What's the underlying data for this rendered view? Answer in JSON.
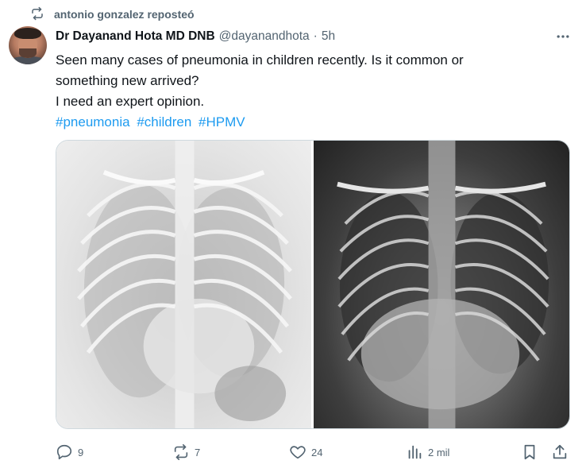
{
  "repost": {
    "text": "antonio gonzalez reposteó",
    "icon": "repost-icon"
  },
  "author": {
    "name": "Dr Dayanand Hota MD DNB",
    "handle": "@dayanandhota",
    "separator": "·",
    "time": "5h"
  },
  "body": {
    "lines": [
      "Seen many cases of pneumonia in children recently. Is it common or",
      "something new arrived?",
      "I need an expert opinion."
    ],
    "hashtags": [
      "#pneumonia",
      "#children",
      "#HPMV"
    ]
  },
  "media": {
    "images": [
      "chest-xray-left",
      "chest-xray-right"
    ]
  },
  "actions": {
    "replies": "9",
    "reposts": "7",
    "likes": "24",
    "views": "2 mil"
  },
  "colors": {
    "link": "#1d9bf0",
    "muted": "#536471",
    "text": "#0f1419",
    "border": "#cfd9de"
  }
}
